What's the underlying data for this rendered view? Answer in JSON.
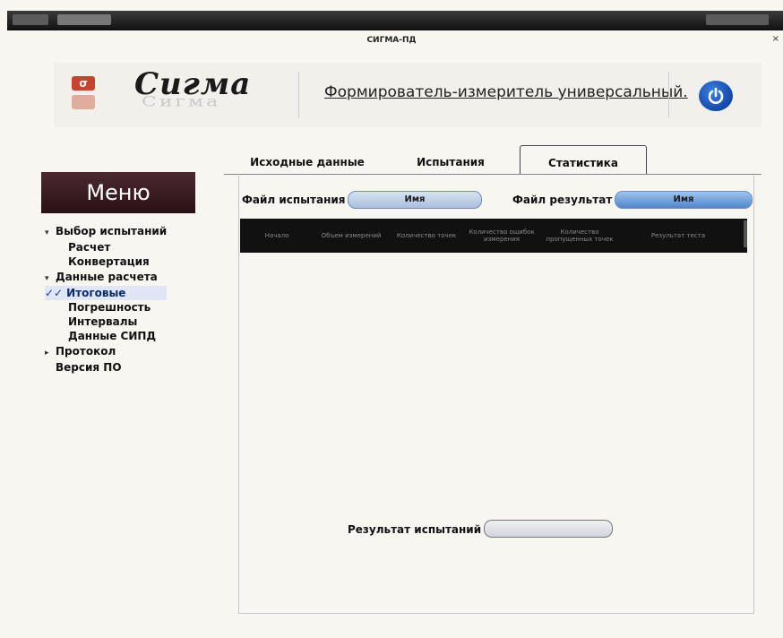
{
  "window": {
    "title": "СИГМА-ПД",
    "close_glyph": "×"
  },
  "header": {
    "logo_letter": "σ",
    "brand": "Сигма",
    "subtitle": "Формирователь-измеритель универсальный."
  },
  "menu": {
    "title": "Меню",
    "items": [
      {
        "label": "Выбор испытаний",
        "marker": "▾"
      },
      {
        "label": "Расчет"
      },
      {
        "label": "Конвертация"
      },
      {
        "label": "Данные расчета",
        "marker": "▾"
      },
      {
        "label": "Итоговые",
        "marker": "✓✓"
      },
      {
        "label": "Погрешность"
      },
      {
        "label": "Интервалы"
      },
      {
        "label": "Данные СИПД"
      },
      {
        "label": "Протокол",
        "marker": "▸"
      },
      {
        "label": "Версия ПО"
      }
    ]
  },
  "tabs": [
    {
      "label": "Исходные данные"
    },
    {
      "label": "Испытания"
    },
    {
      "label": "Статистика"
    }
  ],
  "active_tab_index": 2,
  "stats": {
    "file_test_label": "Файл испытания",
    "file_test_value": "Имя",
    "file_result_label": "Файл результат",
    "file_result_value": "Имя",
    "table_headers": [
      "Начало",
      "Объем измерений",
      "Количество точек",
      "Количество ошибок измерения",
      "Количество пропущенных точек",
      "Результат теста"
    ],
    "result_label": "Результат испытаний",
    "result_value": ""
  },
  "colors": {
    "accent": "#1f3c8a",
    "menu_header": "#3a1c22",
    "power": "#1448a8"
  }
}
